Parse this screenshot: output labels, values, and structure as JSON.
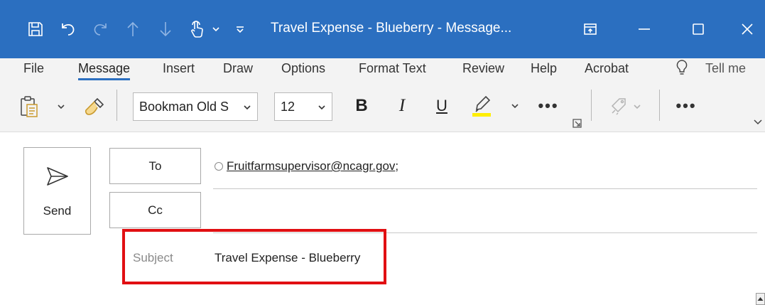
{
  "window": {
    "title": "Travel Expense - Blueberry  -  Message..."
  },
  "ribbon": {
    "tabs": [
      {
        "label": "File"
      },
      {
        "label": "Message"
      },
      {
        "label": "Insert"
      },
      {
        "label": "Draw"
      },
      {
        "label": "Options"
      },
      {
        "label": "Format Text"
      },
      {
        "label": "Review"
      },
      {
        "label": "Help"
      },
      {
        "label": "Acrobat"
      },
      {
        "label": "Tell me"
      }
    ],
    "active_tab": "Message"
  },
  "toolbar": {
    "font_name": "Bookman Old S",
    "font_size": "12",
    "bold": "B",
    "italic": "I",
    "underline": "U",
    "more": "•••",
    "more2": "•••"
  },
  "compose": {
    "send_label": "Send",
    "to_label": "To",
    "cc_label": "Cc",
    "to_recipient": "Fruitfarmsupervisor@ncagr.gov",
    "recipient_suffix": ";",
    "subject_label": "Subject",
    "subject_value": "Travel Expense - Blueberry"
  },
  "colors": {
    "titlebar": "#2b6fc0",
    "ribbon_bg": "#f3f3f3",
    "highlight_border": "#e10f12",
    "highlighter_yellow": "#ffee00"
  },
  "icons": [
    "save-icon",
    "undo-icon",
    "redo-icon",
    "arrow-up-icon",
    "arrow-down-icon",
    "touch-mode-icon",
    "customize-qat-icon",
    "restore-window-icon",
    "minimize-icon",
    "maximize-icon",
    "close-icon",
    "lightbulb-icon",
    "paste-icon",
    "format-painter-icon",
    "highlighter-icon",
    "dialog-launcher-icon",
    "sensitivity-icon",
    "send-icon"
  ]
}
